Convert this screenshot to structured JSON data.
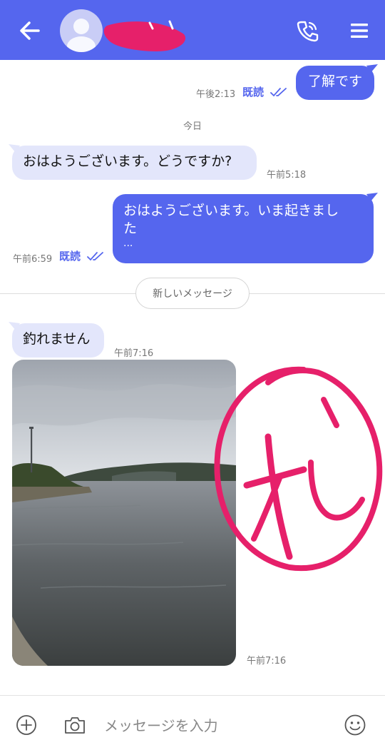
{
  "colors": {
    "accent": "#5566ee",
    "incoming_bubble": "#e3e6fb",
    "scribble": "#e6206a"
  },
  "header": {
    "back_icon": "arrow-left-icon",
    "call_icon": "phone-icon",
    "menu_icon": "hamburger-menu-icon"
  },
  "messages": [
    {
      "direction": "out",
      "text": "了解です",
      "time": "午後2:13",
      "status": "既読"
    },
    {
      "direction": "in",
      "text": "おはようございます。どうですか?",
      "time": "午前5:18"
    },
    {
      "direction": "out",
      "line1": "おはようございます。いま起きまし",
      "line2": "た",
      "line3": "...",
      "time": "午前6:59",
      "status": "既読"
    },
    {
      "direction": "in",
      "text": "釣れません",
      "time": "午前7:16"
    },
    {
      "direction": "in",
      "type": "photo",
      "time": "午前7:16"
    }
  ],
  "day_separator": "今日",
  "new_messages_label": "新しいメッセージ",
  "composer": {
    "placeholder": "メッセージを入力",
    "plus_icon": "plus-circle-icon",
    "camera_icon": "camera-icon",
    "emoji_icon": "smiley-icon"
  }
}
